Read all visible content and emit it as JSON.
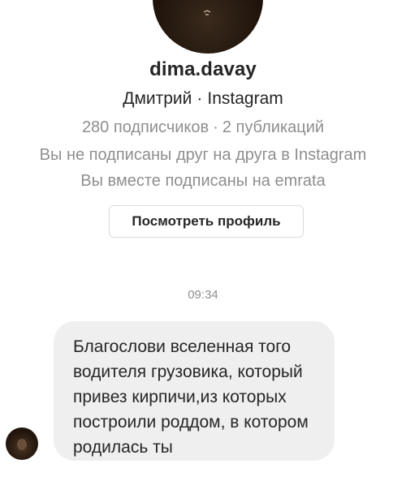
{
  "profile": {
    "username": "dima.davay",
    "full_name": "Дмитрий",
    "separator": "·",
    "platform": "Instagram",
    "followers": "280 подписчиков",
    "posts": "2 публикаций",
    "follow_status": "Вы не подписаны друг на друга в Instagram",
    "mutual": "Вы вместе подписаны на emrata",
    "view_profile_label": "Посмотреть профиль"
  },
  "chat": {
    "timestamp": "09:34",
    "messages": [
      {
        "lines": [
          "Благослови вселенная того",
          "водителя грузовика, который",
          "привез кирпичи,из которых",
          "построили роддом, в котором",
          "родилась ты"
        ]
      }
    ]
  },
  "colors": {
    "text": "#262626",
    "secondary": "#8e8e8e",
    "bubble": "#efefef",
    "border": "#dbdbdb"
  }
}
